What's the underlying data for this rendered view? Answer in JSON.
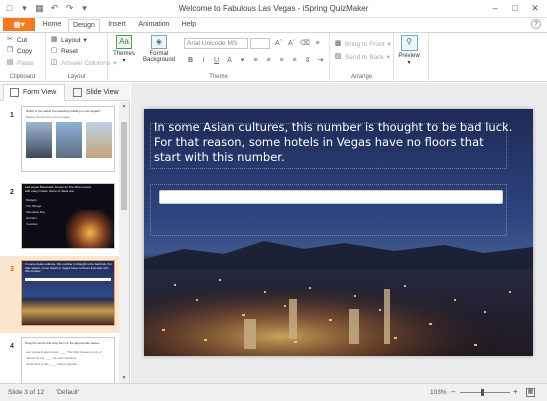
{
  "window": {
    "title": "Welcome to Fabulous Las Vegas - iSpring QuizMaker"
  },
  "qat_icons": [
    "new-icon",
    "open-icon",
    "save-icon",
    "undo-icon",
    "redo-icon",
    "dropdown-icon"
  ],
  "menu": {
    "file_label": "",
    "tabs": [
      "Home",
      "Design",
      "Insert",
      "Animation",
      "Help"
    ],
    "active_tab": "Design"
  },
  "ribbon": {
    "clipboard": {
      "cut": "Cut",
      "copy": "Copy",
      "paste": "Paste",
      "label": "Clipboard"
    },
    "layout": {
      "layout": "Layout",
      "reset": "Reset",
      "answer_columns": "Answer Columns",
      "label": "Layout"
    },
    "theme": {
      "themes": "Themes",
      "format_background_line1": "Format",
      "format_background_line2": "Background",
      "font_name": "Arial Unicode MS",
      "label": "Theme"
    },
    "arrange": {
      "bring_to_front": "Bring to Front",
      "send_to_back": "Send to Back",
      "label": "Arrange"
    },
    "preview": {
      "label": "Preview"
    }
  },
  "left_panel": {
    "form_view": "Form View",
    "slide_view": "Slide View",
    "slides": [
      {
        "number": "1",
        "title": "Which is the tallest free-standing building in Las Vegas?",
        "subtitle": "Please choose the correct image."
      },
      {
        "number": "2",
        "title": "Las Vegas Boulevard, known as The Strip is lined with many hotels. Some of these are:",
        "options": [
          "Bellagio",
          "The Mirage",
          "Mandalay Bay",
          "Harrah's",
          "Venetian"
        ]
      },
      {
        "number": "3",
        "title": "In some Asian cultures, this number is thought to be bad luck. For that reason, some hotels in Vegas have no floors that start with this number."
      },
      {
        "number": "4",
        "title": "Drag the words and drop them to the appropriate places",
        "fill": [
          "Las Vegas is also known",
          "The Strip houses many of",
          "named for the",
          "the slot machines",
          "drinks and meals",
          "always gamble"
        ]
      }
    ]
  },
  "slide": {
    "question": "In some Asian cultures, this number is thought to be bad luck. For that reason, some hotels in Vegas have no floors that start with this number.",
    "answer_value": ""
  },
  "statusbar": {
    "slide_info": "Slide 3 of 12",
    "theme": "'Default'",
    "zoom": "103%"
  },
  "colors": {
    "accent": "#f47b20",
    "selected_slide": "#fde6cf",
    "slide_sky_top": "#1e2a57",
    "slide_sky_bottom": "#324a86"
  }
}
